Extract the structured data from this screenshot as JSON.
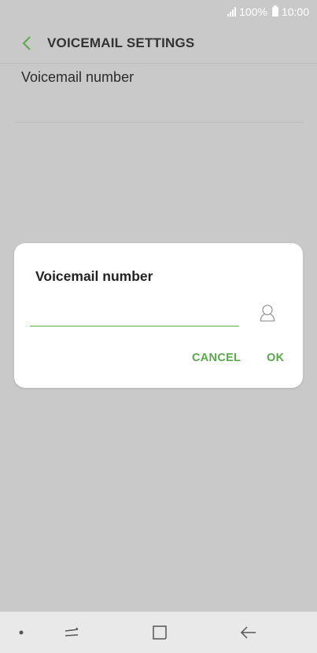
{
  "status_bar": {
    "battery": "100%",
    "time": "10:00",
    "icons": [
      "signal-icon",
      "battery-icon"
    ]
  },
  "header": {
    "title": "VOICEMAIL SETTINGS",
    "back_icon": "chevron-left-icon"
  },
  "settings": {
    "items": [
      {
        "label": "Voicemail number"
      }
    ]
  },
  "dialog": {
    "title": "Voicemail number",
    "input_value": "",
    "input_placeholder": "",
    "contact_icon": "contact-icon",
    "cancel_label": "CANCEL",
    "ok_label": "OK"
  },
  "navbar": {
    "icons": [
      "dot-icon",
      "recent-apps-icon",
      "home-icon",
      "back-arrow-icon"
    ]
  },
  "colors": {
    "accent": "#5aa94a",
    "background": "#c9c9c9",
    "dialog": "#ffffff",
    "navbar": "#e9e9e9"
  }
}
